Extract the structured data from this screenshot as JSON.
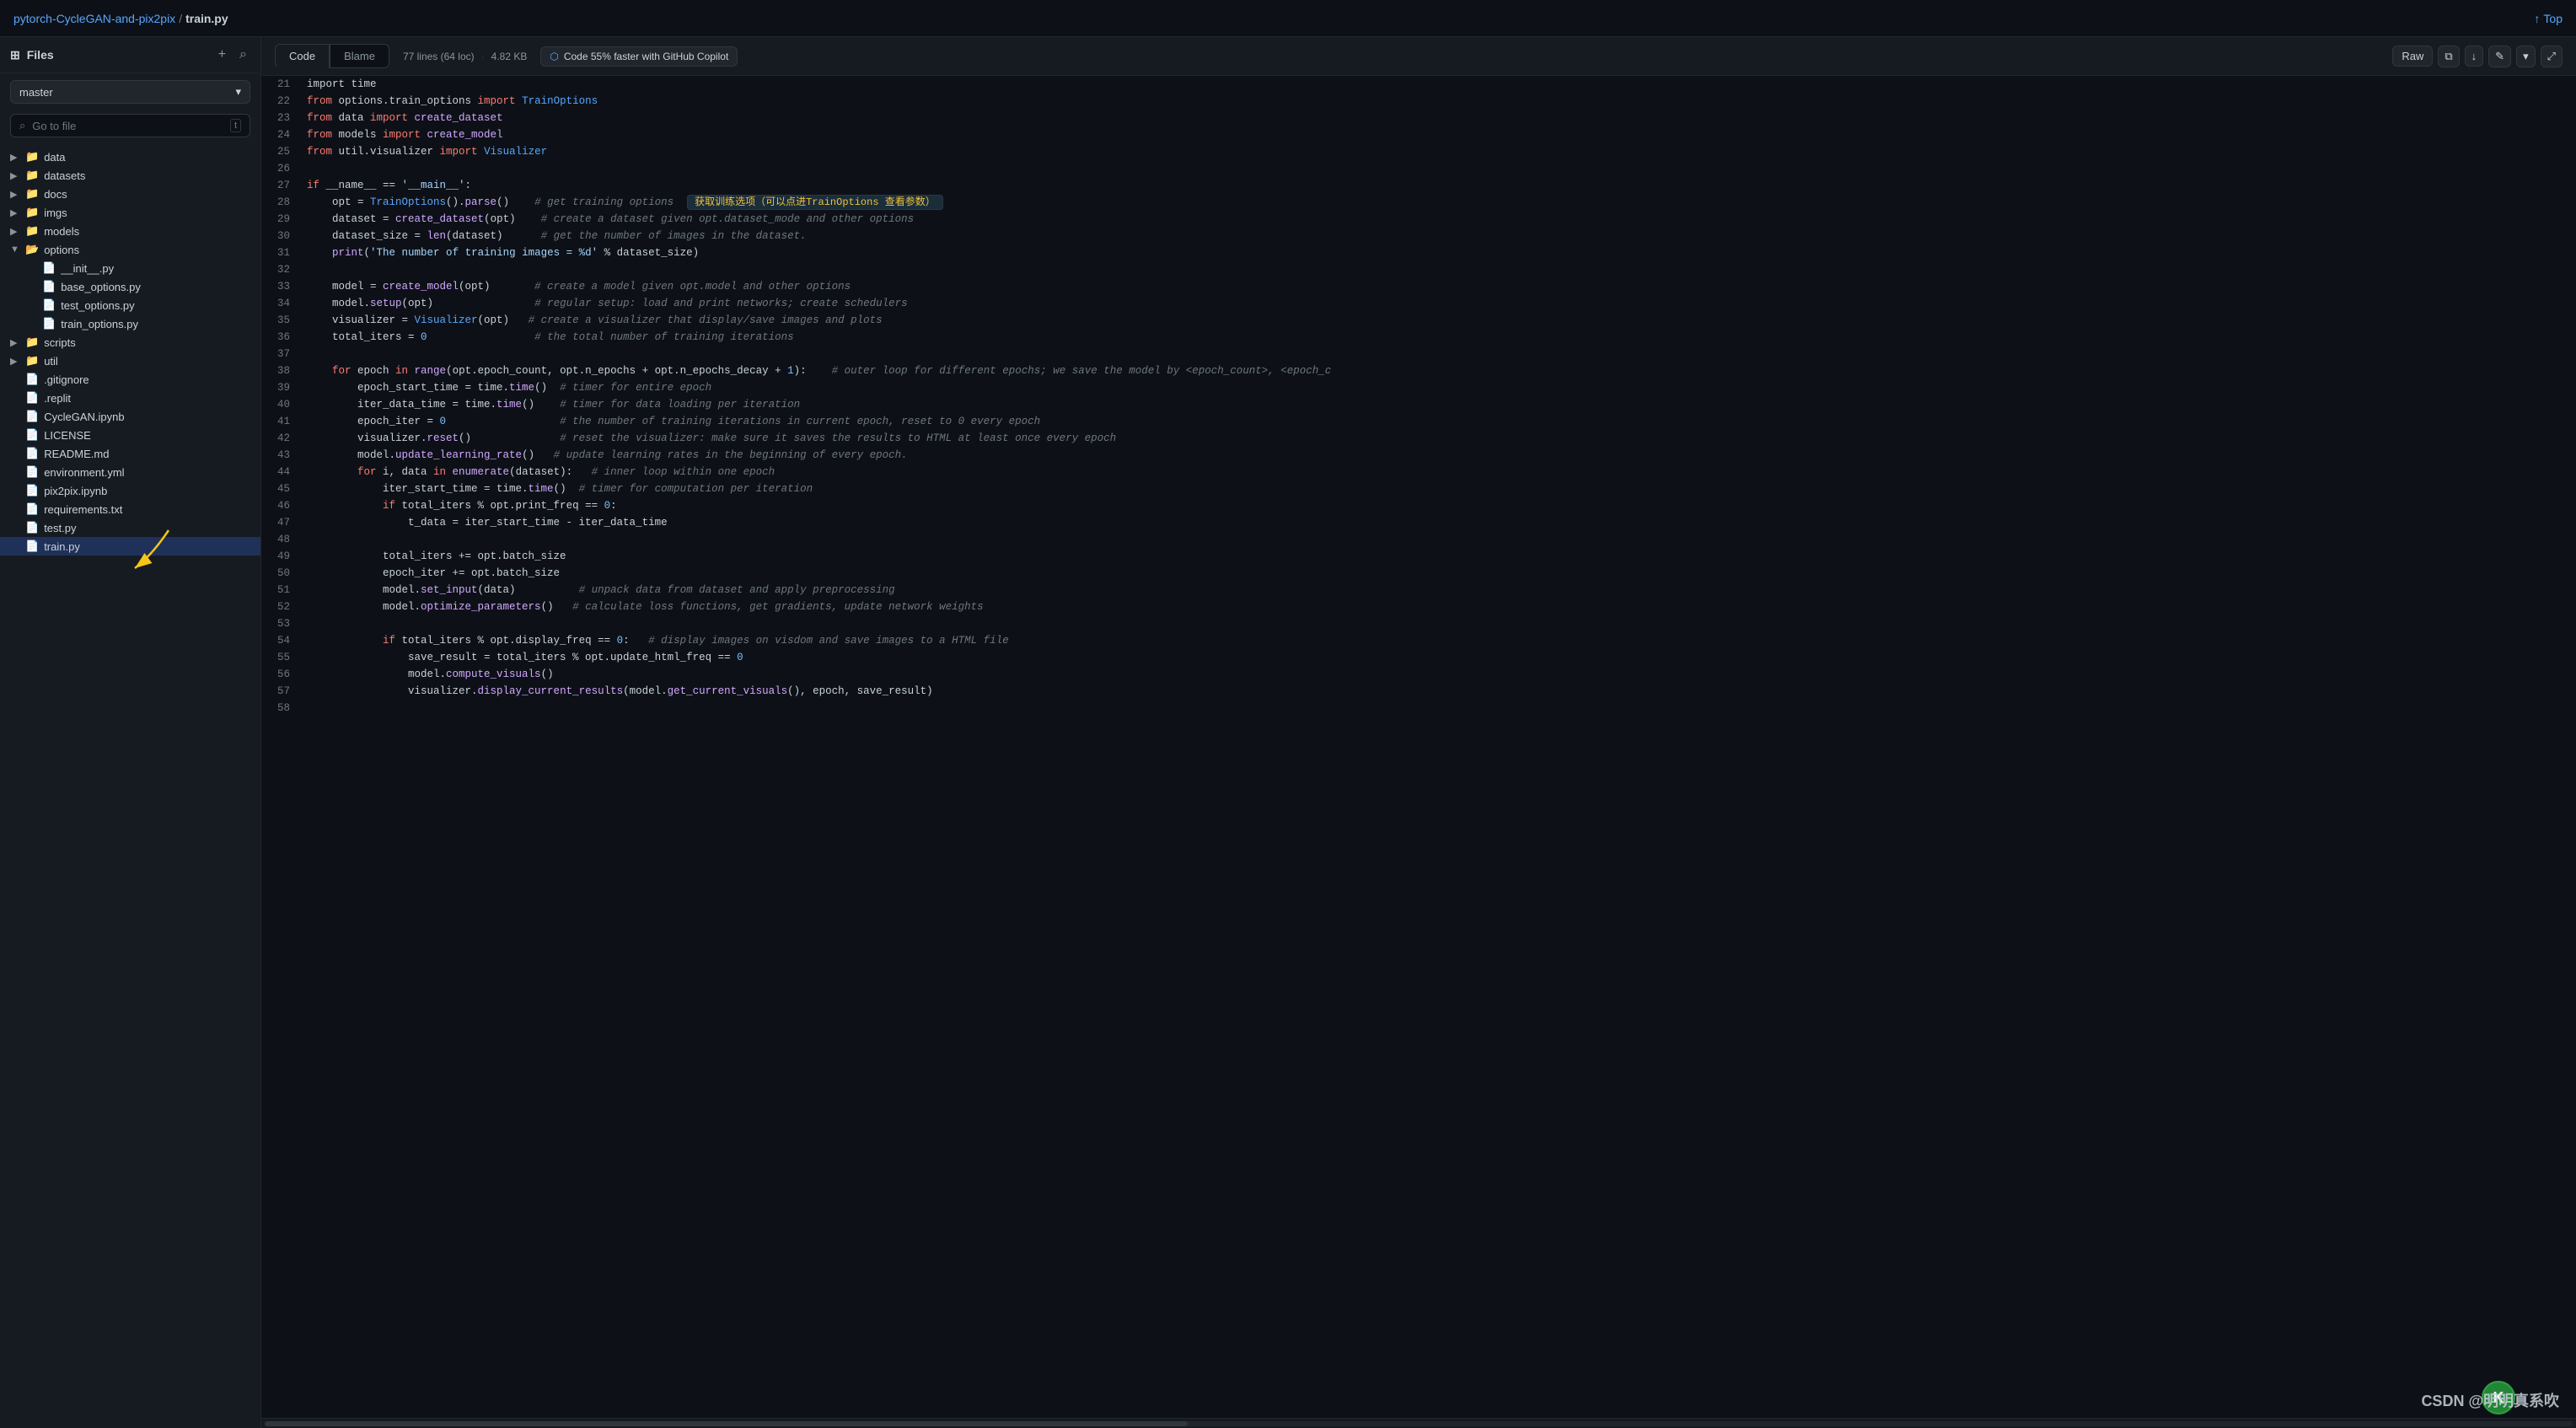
{
  "sidebar": {
    "title": "Files",
    "branch": "master",
    "search_placeholder": "Go to file",
    "search_shortcut": "t",
    "items": [
      {
        "id": "data",
        "type": "folder",
        "label": "data",
        "level": 0,
        "expanded": false
      },
      {
        "id": "datasets",
        "type": "folder",
        "label": "datasets",
        "level": 0,
        "expanded": false
      },
      {
        "id": "docs",
        "type": "folder",
        "label": "docs",
        "level": 0,
        "expanded": false
      },
      {
        "id": "imgs",
        "type": "folder",
        "label": "imgs",
        "level": 0,
        "expanded": false
      },
      {
        "id": "models",
        "type": "folder",
        "label": "models",
        "level": 0,
        "expanded": false
      },
      {
        "id": "options",
        "type": "folder",
        "label": "options",
        "level": 0,
        "expanded": true
      },
      {
        "id": "__init__.py",
        "type": "file",
        "label": "__init__.py",
        "level": 1
      },
      {
        "id": "base_options.py",
        "type": "file",
        "label": "base_options.py",
        "level": 1
      },
      {
        "id": "test_options.py",
        "type": "file",
        "label": "test_options.py",
        "level": 1
      },
      {
        "id": "train_options.py",
        "type": "file",
        "label": "train_options.py",
        "level": 1
      },
      {
        "id": "scripts",
        "type": "folder",
        "label": "scripts",
        "level": 0,
        "expanded": false
      },
      {
        "id": "util",
        "type": "folder",
        "label": "util",
        "level": 0,
        "expanded": false
      },
      {
        "id": ".gitignore",
        "type": "file",
        "label": ".gitignore",
        "level": 0
      },
      {
        "id": ".replit",
        "type": "file",
        "label": ".replit",
        "level": 0
      },
      {
        "id": "CycleGAN.ipynb",
        "type": "file",
        "label": "CycleGAN.ipynb",
        "level": 0
      },
      {
        "id": "LICENSE",
        "type": "file",
        "label": "LICENSE",
        "level": 0
      },
      {
        "id": "README.md",
        "type": "file",
        "label": "README.md",
        "level": 0
      },
      {
        "id": "environment.yml",
        "type": "file",
        "label": "environment.yml",
        "level": 0
      },
      {
        "id": "pix2pix.ipynb",
        "type": "file",
        "label": "pix2pix.ipynb",
        "level": 0
      },
      {
        "id": "requirements.txt",
        "type": "file",
        "label": "requirements.txt",
        "level": 0
      },
      {
        "id": "test.py",
        "type": "file",
        "label": "test.py",
        "level": 0
      },
      {
        "id": "train.py",
        "type": "file",
        "label": "train.py",
        "level": 0,
        "active": true
      }
    ]
  },
  "breadcrumb": {
    "repo": "pytorch-CycleGAN-and-pix2pix",
    "file": "train.py"
  },
  "top_link": "Top",
  "file_info": {
    "lines": "77 lines (64 loc)",
    "size": "4.82 KB",
    "tab_code": "Code",
    "tab_blame": "Blame",
    "copilot_text": "Code 55% faster with GitHub Copilot",
    "raw_label": "Raw"
  },
  "code": {
    "annotation_text": "获取训练选项（可以点进TrainOptions 查看参数）",
    "lines": [
      {
        "num": "21",
        "content": "import time"
      },
      {
        "num": "22",
        "content": "from options.train_options import TrainOptions",
        "parts": [
          {
            "t": "kw",
            "v": "from "
          },
          {
            "t": "",
            "v": "options.train_options "
          },
          {
            "t": "kw",
            "v": "import "
          },
          {
            "t": "cn",
            "v": "TrainOptions"
          }
        ]
      },
      {
        "num": "23",
        "content": "from data import create_dataset",
        "parts": [
          {
            "t": "kw",
            "v": "from "
          },
          {
            "t": "",
            "v": "data "
          },
          {
            "t": "kw",
            "v": "import "
          },
          {
            "t": "fn",
            "v": "create_dataset"
          }
        ]
      },
      {
        "num": "24",
        "content": "from models import create_model",
        "parts": [
          {
            "t": "kw",
            "v": "from "
          },
          {
            "t": "",
            "v": "models "
          },
          {
            "t": "kw",
            "v": "import "
          },
          {
            "t": "fn",
            "v": "create_model"
          }
        ]
      },
      {
        "num": "25",
        "content": "from util.visualizer import Visualizer",
        "parts": [
          {
            "t": "kw",
            "v": "from "
          },
          {
            "t": "",
            "v": "util.visualizer "
          },
          {
            "t": "kw",
            "v": "import "
          },
          {
            "t": "cn",
            "v": "Visualizer"
          }
        ]
      },
      {
        "num": "26",
        "content": ""
      },
      {
        "num": "27",
        "content": "if __name__ == '__main__':",
        "parts": [
          {
            "t": "kw",
            "v": "if "
          },
          {
            "t": "",
            "v": "__name__ == "
          },
          {
            "t": "str",
            "v": "'__main__'"
          },
          {
            "t": "",
            "v": ":"
          }
        ]
      },
      {
        "num": "28",
        "content": "    opt = TrainOptions().parse()    # get training options",
        "parts": [
          {
            "t": "",
            "v": "    opt = "
          },
          {
            "t": "cn",
            "v": "TrainOptions"
          },
          {
            "t": "",
            "v": "()."
          },
          {
            "t": "fn",
            "v": "parse"
          },
          {
            "t": "",
            "v": "()    "
          },
          {
            "t": "cm",
            "v": "# get training options"
          }
        ],
        "has_annotation": true
      },
      {
        "num": "29",
        "content": "    dataset = create_dataset(opt)    # create a dataset given opt.dataset_mode and other options",
        "parts": [
          {
            "t": "",
            "v": "    dataset = "
          },
          {
            "t": "fn",
            "v": "create_dataset"
          },
          {
            "t": "",
            "v": "(opt)    "
          },
          {
            "t": "cm",
            "v": "# create a dataset given opt.dataset_mode and other options"
          }
        ]
      },
      {
        "num": "30",
        "content": "    dataset_size = len(dataset)      # get the number of images in the dataset.",
        "parts": [
          {
            "t": "",
            "v": "    dataset_size = "
          },
          {
            "t": "fn",
            "v": "len"
          },
          {
            "t": "",
            "v": "(dataset)      "
          },
          {
            "t": "cm",
            "v": "# get the number of images in the dataset."
          }
        ]
      },
      {
        "num": "31",
        "content": "    print('The number of training images = %d' % dataset_size)",
        "parts": [
          {
            "t": "",
            "v": "    "
          },
          {
            "t": "fn",
            "v": "print"
          },
          {
            "t": "",
            "v": "("
          },
          {
            "t": "str",
            "v": "'The number of training images = %d'"
          },
          {
            "t": "",
            "v": " % dataset_size)"
          }
        ]
      },
      {
        "num": "32",
        "content": ""
      },
      {
        "num": "33",
        "content": "    model = create_model(opt)       # create a model given opt.model and other options",
        "parts": [
          {
            "t": "",
            "v": "    model = "
          },
          {
            "t": "fn",
            "v": "create_model"
          },
          {
            "t": "",
            "v": "(opt)       "
          },
          {
            "t": "cm",
            "v": "# create a model given opt.model and other options"
          }
        ]
      },
      {
        "num": "34",
        "content": "    model.setup(opt)                # regular setup: load and print networks; create schedulers",
        "parts": [
          {
            "t": "",
            "v": "    model."
          },
          {
            "t": "fn",
            "v": "setup"
          },
          {
            "t": "",
            "v": "(opt)                "
          },
          {
            "t": "cm",
            "v": "# regular setup: load and print networks; create schedulers"
          }
        ]
      },
      {
        "num": "35",
        "content": "    visualizer = Visualizer(opt)   # create a visualizer that display/save images and plots",
        "parts": [
          {
            "t": "",
            "v": "    visualizer = "
          },
          {
            "t": "cn",
            "v": "Visualizer"
          },
          {
            "t": "",
            "v": "(opt)   "
          },
          {
            "t": "cm",
            "v": "# create a visualizer that display/save images and plots"
          }
        ]
      },
      {
        "num": "36",
        "content": "    total_iters = 0                 # the total number of training iterations",
        "parts": [
          {
            "t": "",
            "v": "    total_iters = "
          },
          {
            "t": "num",
            "v": "0"
          },
          {
            "t": "",
            "v": "                 "
          },
          {
            "t": "cm",
            "v": "# the total number of training iterations"
          }
        ]
      },
      {
        "num": "37",
        "content": ""
      },
      {
        "num": "38",
        "content": "    for epoch in range(opt.epoch_count, opt.n_epochs + opt.n_epochs_decay + 1):    # outer loop for different epochs; we save the model by <epoch_count>, <epoch_c",
        "parts": [
          {
            "t": "kw",
            "v": "    for "
          },
          {
            "t": "",
            "v": "epoch "
          },
          {
            "t": "kw",
            "v": "in "
          },
          {
            "t": "fn",
            "v": "range"
          },
          {
            "t": "",
            "v": "(opt.epoch_count, opt.n_epochs + opt.n_epochs_decay + "
          },
          {
            "t": "num",
            "v": "1"
          },
          {
            "t": "",
            "v": "):    "
          },
          {
            "t": "cm",
            "v": "# outer loop for different epochs; we save the model by <epoch_count>, <epoch_c"
          }
        ]
      },
      {
        "num": "39",
        "content": "        epoch_start_time = time.time()  # timer for entire epoch",
        "parts": [
          {
            "t": "",
            "v": "        epoch_start_time = time."
          },
          {
            "t": "fn",
            "v": "time"
          },
          {
            "t": "",
            "v": "()  "
          },
          {
            "t": "cm",
            "v": "# timer for entire epoch"
          }
        ]
      },
      {
        "num": "40",
        "content": "        iter_data_time = time.time()    # timer for data loading per iteration",
        "parts": [
          {
            "t": "",
            "v": "        iter_data_time = time."
          },
          {
            "t": "fn",
            "v": "time"
          },
          {
            "t": "",
            "v": "()    "
          },
          {
            "t": "cm",
            "v": "# timer for data loading per iteration"
          }
        ]
      },
      {
        "num": "41",
        "content": "        epoch_iter = 0                  # the number of training iterations in current epoch, reset to 0 every epoch",
        "parts": [
          {
            "t": "",
            "v": "        epoch_iter = "
          },
          {
            "t": "num",
            "v": "0"
          },
          {
            "t": "",
            "v": "                  "
          },
          {
            "t": "cm",
            "v": "# the number of training iterations in current epoch, reset to 0 every epoch"
          }
        ]
      },
      {
        "num": "42",
        "content": "        visualizer.reset()              # reset the visualizer: make sure it saves the results to HTML at least once every epoch",
        "parts": [
          {
            "t": "",
            "v": "        visualizer."
          },
          {
            "t": "fn",
            "v": "reset"
          },
          {
            "t": "",
            "v": "()              "
          },
          {
            "t": "cm",
            "v": "# reset the visualizer: make sure it saves the results to HTML at least once every epoch"
          }
        ]
      },
      {
        "num": "43",
        "content": "        model.update_learning_rate()   # update learning rates in the beginning of every epoch.",
        "parts": [
          {
            "t": "",
            "v": "        model."
          },
          {
            "t": "fn",
            "v": "update_learning_rate"
          },
          {
            "t": "",
            "v": "()   "
          },
          {
            "t": "cm",
            "v": "# update learning rates in the beginning of every epoch."
          }
        ]
      },
      {
        "num": "44",
        "content": "        for i, data in enumerate(dataset):   # inner loop within one epoch",
        "parts": [
          {
            "t": "kw",
            "v": "        for "
          },
          {
            "t": "",
            "v": "i, data "
          },
          {
            "t": "kw",
            "v": "in "
          },
          {
            "t": "fn",
            "v": "enumerate"
          },
          {
            "t": "",
            "v": "(dataset):   "
          },
          {
            "t": "cm",
            "v": "# inner loop within one epoch"
          }
        ]
      },
      {
        "num": "45",
        "content": "            iter_start_time = time.time()  # timer for computation per iteration",
        "parts": [
          {
            "t": "",
            "v": "            iter_start_time = time."
          },
          {
            "t": "fn",
            "v": "time"
          },
          {
            "t": "",
            "v": "()  "
          },
          {
            "t": "cm",
            "v": "# timer for computation per iteration"
          }
        ]
      },
      {
        "num": "46",
        "content": "            if total_iters % opt.print_freq == 0:",
        "parts": [
          {
            "t": "kw",
            "v": "            if "
          },
          {
            "t": "",
            "v": "total_iters % opt.print_freq == "
          },
          {
            "t": "num",
            "v": "0"
          },
          {
            "t": "",
            "v": ":"
          }
        ]
      },
      {
        "num": "47",
        "content": "                t_data = iter_start_time - iter_data_time"
      },
      {
        "num": "48",
        "content": ""
      },
      {
        "num": "49",
        "content": "            total_iters += opt.batch_size"
      },
      {
        "num": "50",
        "content": "            epoch_iter += opt.batch_size"
      },
      {
        "num": "51",
        "content": "            model.set_input(data)          # unpack data from dataset and apply preprocessing",
        "parts": [
          {
            "t": "",
            "v": "            model."
          },
          {
            "t": "fn",
            "v": "set_input"
          },
          {
            "t": "",
            "v": "(data)          "
          },
          {
            "t": "cm",
            "v": "# unpack data from dataset and apply preprocessing"
          }
        ]
      },
      {
        "num": "52",
        "content": "            model.optimize_parameters()   # calculate loss functions, get gradients, update network weights",
        "parts": [
          {
            "t": "",
            "v": "            model."
          },
          {
            "t": "fn",
            "v": "optimize_parameters"
          },
          {
            "t": "",
            "v": "()   "
          },
          {
            "t": "cm",
            "v": "# calculate loss functions, get gradients, update network weights"
          }
        ]
      },
      {
        "num": "53",
        "content": ""
      },
      {
        "num": "54",
        "content": "            if total_iters % opt.display_freq == 0:   # display images on visdom and save images to a HTML file",
        "parts": [
          {
            "t": "kw",
            "v": "            if "
          },
          {
            "t": "",
            "v": "total_iters % opt.display_freq == "
          },
          {
            "t": "num",
            "v": "0"
          },
          {
            "t": "",
            "v": ":   "
          },
          {
            "t": "cm",
            "v": "# display images on visdom and save images to a HTML file"
          }
        ]
      },
      {
        "num": "55",
        "content": "                save_result = total_iters % opt.update_html_freq == 0",
        "parts": [
          {
            "t": "",
            "v": "                save_result = total_iters % opt.update_html_freq == "
          },
          {
            "t": "num",
            "v": "0"
          }
        ]
      },
      {
        "num": "56",
        "content": "                model.compute_visuals()",
        "parts": [
          {
            "t": "",
            "v": "                model."
          },
          {
            "t": "fn",
            "v": "compute_visuals"
          },
          {
            "t": "",
            "v": "()"
          }
        ]
      },
      {
        "num": "57",
        "content": "                visualizer.display_current_results(model.get_current_visuals(), epoch, save_result)",
        "parts": [
          {
            "t": "",
            "v": "                visualizer."
          },
          {
            "t": "fn",
            "v": "display_current_results"
          },
          {
            "t": "",
            "v": "(model."
          },
          {
            "t": "fn",
            "v": "get_current_visuals"
          },
          {
            "t": "",
            "v": "(), epoch, save_result)"
          }
        ]
      },
      {
        "num": "58",
        "content": ""
      }
    ]
  },
  "watermark": "CSDN @明明真系吹"
}
